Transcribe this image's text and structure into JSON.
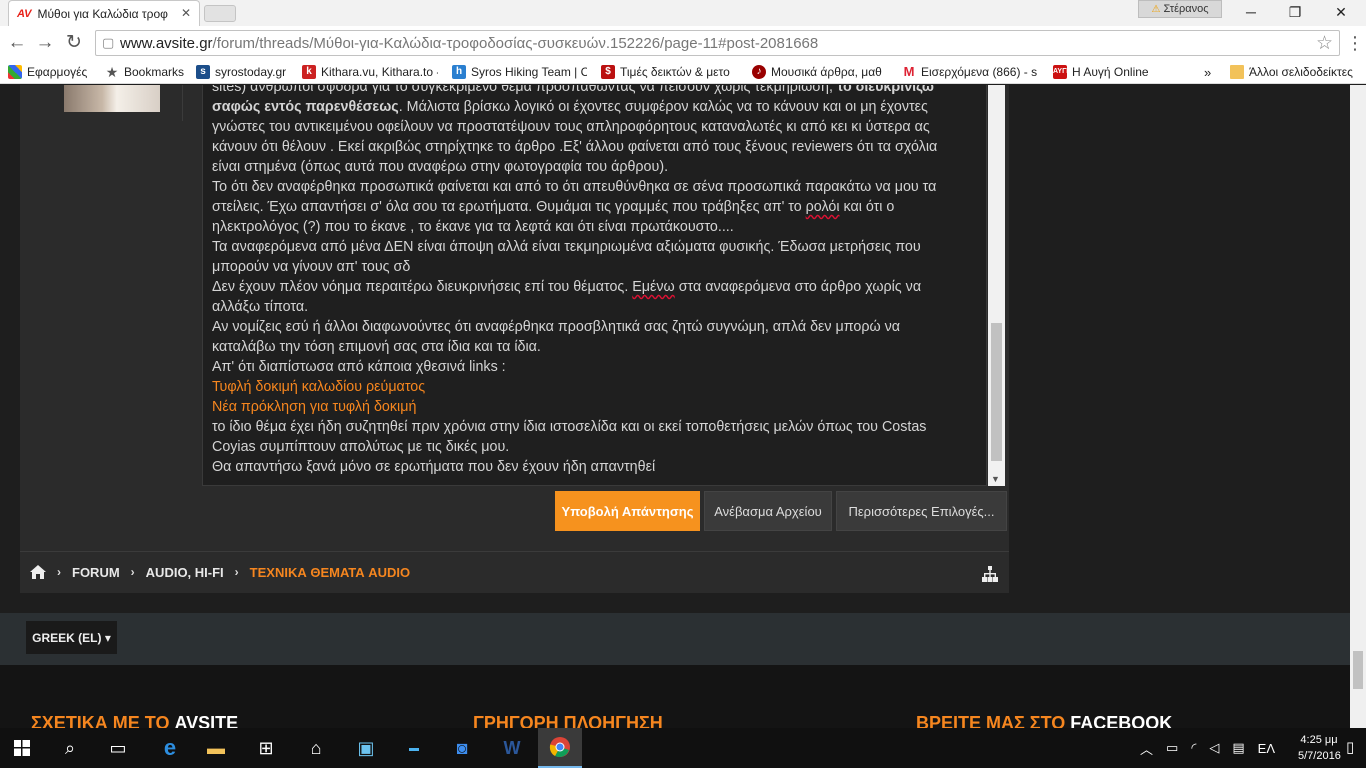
{
  "browser": {
    "tab_title": "Μύθοι για Καλώδια τροφ",
    "tab_favicon": "AV",
    "user_name": "Στέρανος",
    "url_host": "www.avsite.gr",
    "url_path": "/forum/threads/Μύθοι-για-Καλώδια-τροφοδοσίας-συσκευών.152226/page-11#post-2081668",
    "bookmarks": [
      {
        "label": "Εφαρμογές",
        "icon": "apps-icon"
      },
      {
        "label": "Bookmarks",
        "icon": "star-icon"
      },
      {
        "label": "syrostoday.gr",
        "icon": "st-icon"
      },
      {
        "label": "Kithara.vu, Kithara.to -",
        "icon": "kithara-icon"
      },
      {
        "label": "Syros Hiking Team | C",
        "icon": "hiker-icon"
      },
      {
        "label": "Τιμές δεικτών & μετο",
        "icon": "index-icon"
      },
      {
        "label": "Μουσικά άρθρα, μαθ",
        "icon": "music-icon"
      },
      {
        "label": "Εισερχόμενα (866) - s",
        "icon": "gmail-icon"
      },
      {
        "label": "Η Αυγή Online",
        "icon": "avgi-icon"
      }
    ],
    "bookmarks_more": "»",
    "other_bookmarks": "Άλλοι σελιδοδείκτες"
  },
  "post": {
    "lines": [
      {
        "parts": [
          {
            "t": "sites) άνθρωποι σφόδρα για το συγκεκριμένο θέμα προσπαθώντας να πείσουν χωρίς τεκμηρίωση, "
          },
          {
            "t": "το διευκρινίζω",
            "b": true
          }
        ]
      },
      {
        "parts": [
          {
            "t": "σαφώς εντός παρενθέσεως",
            "b": true
          },
          {
            "t": ". Μάλιστα  βρίσκω λογικό οι έχοντες συμφέρον καλώς να το κάνουν και οι μη έχοντες"
          }
        ]
      },
      {
        "parts": [
          {
            "t": "γνώστες του αντικειμένου οφείλουν να προστατέψουν τους απληροφόρητους καταναλωτές κι από κει κι ύστερα ας"
          }
        ]
      },
      {
        "parts": [
          {
            "t": "κάνουν ότι θέλουν . Εκεί ακριβώς στηρίχτηκε το άρθρο .Εξ' άλλου φαίνεται από τους ξένους reviewers ότι τα σχόλια"
          }
        ]
      },
      {
        "parts": [
          {
            "t": "είναι στημένα (όπως αυτά που αναφέρω στην φωτογραφία του άρθρου)."
          }
        ]
      },
      {
        "parts": [
          {
            "t": "Το ότι δεν αναφέρθηκα προσωπικά φαίνεται και από το ότι απευθύνθηκα σε σένα προσωπικά παρακάτω να μου τα"
          }
        ]
      },
      {
        "parts": [
          {
            "t": "στείλεις. Έχω απαντήσει σ' όλα σου τα ερωτήματα. Θυμάμαι τις γραμμές που τράβηξες απ' το "
          },
          {
            "t": "ρολόι",
            "sp": true
          },
          {
            "t": " και ότι ο"
          }
        ]
      },
      {
        "parts": [
          {
            "t": "ηλεκτρολόγος (?) που το έκανε , το έκανε για τα λεφτά και ότι είναι πρωτάκουστο...."
          }
        ]
      },
      {
        "parts": [
          {
            "t": "Τα αναφερόμενα από μένα ΔΕΝ είναι άποψη αλλά είναι τεκμηριωμένα αξιώματα φυσικής. Έδωσα μετρήσεις που"
          }
        ]
      },
      {
        "parts": [
          {
            "t": "μπορούν να γίνουν απ' τους σδ"
          }
        ]
      },
      {
        "parts": [
          {
            "t": "Δεν έχουν πλέον νόημα περαιτέρω διευκρινήσεις επί του θέματος. "
          },
          {
            "t": "Εμένω",
            "sp": true
          },
          {
            "t": " στα αναφερόμενα στο άρθρο χωρίς να"
          }
        ]
      },
      {
        "parts": [
          {
            "t": "αλλάξω τίποτα."
          }
        ]
      },
      {
        "parts": [
          {
            "t": "Αν νομίζεις εσύ ή άλλοι διαφωνούντες ότι αναφέρθηκα προσβλητικά σας ζητώ συγνώμη, απλά δεν μπορώ να"
          }
        ]
      },
      {
        "parts": [
          {
            "t": "καταλάβω την τόση επιμονή σας στα ίδια και τα ίδια."
          }
        ]
      },
      {
        "parts": [
          {
            "t": "Απ' ότι διαπίστωσα από κάποια χθεσινά links :"
          }
        ]
      },
      {
        "parts": [
          {
            "t": "Τυφλή δοκιμή καλωδίου ρεύματος",
            "lk": true
          }
        ]
      },
      {
        "parts": [
          {
            "t": "Νέα πρόκληση για τυφλή δοκιμή",
            "lk": true
          }
        ]
      },
      {
        "parts": [
          {
            "t": "το ίδιο θέμα έχει ήδη συζητηθεί πριν χρόνια στην ίδια ιστοσελίδα και οι εκεί τοποθετήσεις μελών όπως του Costas"
          }
        ]
      },
      {
        "parts": [
          {
            "t": "Coyias συμπίπτουν απολύτως με τις δικές μου."
          }
        ]
      },
      {
        "parts": [
          {
            "t": "Θα απαντήσω ξανά μόνο σε ερωτήματα που δεν έχουν ήδη απαντηθεί"
          }
        ]
      }
    ]
  },
  "actions": {
    "submit": "Υποβολή Απάντησης",
    "upload": "Ανέβασμα Αρχείου",
    "more": "Περισσότερες Επιλογές..."
  },
  "breadcrumb": {
    "items": [
      "FORUM",
      "AUDIO, HI-FI"
    ],
    "current": "ΤΕΧΝΙΚΑ ΘΕΜΑΤΑ AUDIO",
    "separator": "›"
  },
  "language": {
    "label": "GREEK (EL)",
    "caret": "▾"
  },
  "footer": {
    "about_prefix": "ΣΧΕΤΙΚΑ ΜΕ ΤΟ ",
    "about_brand": "AVSITE",
    "nav": "ΓΡΗΓΟΡΗ ΠΛΟΗΓΗΣΗ",
    "find_prefix": "ΒΡΕΙΤΕ ΜΑΣ ΣΤΟ ",
    "find_brand": "FACEBOOK"
  },
  "taskbar": {
    "language": "ΕΛ",
    "time": "4:25 μμ",
    "date": "5/7/2016"
  },
  "colors": {
    "accent": "#f6861f",
    "submit_bg": "#f6921e",
    "page_bg": "#1e1e1e"
  }
}
